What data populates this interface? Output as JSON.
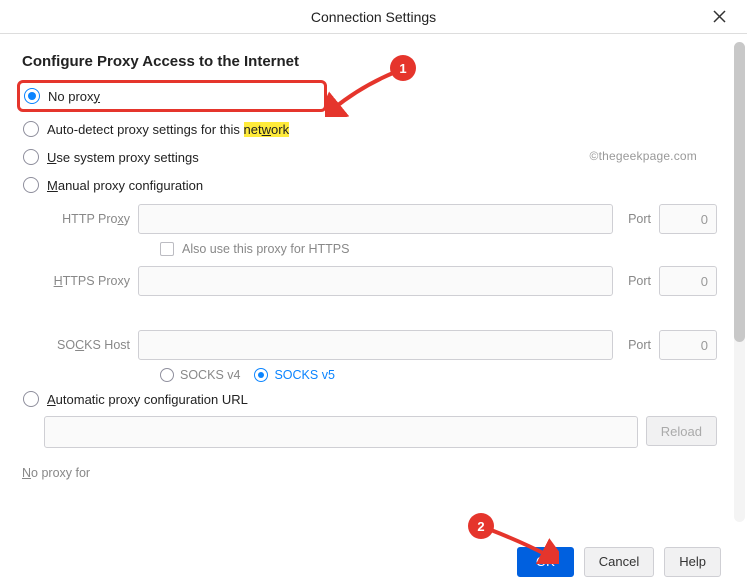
{
  "titlebar": {
    "title": "Connection Settings"
  },
  "section_title": "Configure Proxy Access to the Internet",
  "watermark": "©thegeekpage.com",
  "options": {
    "no_proxy": {
      "pre": "No prox",
      "ul": "y",
      "post": ""
    },
    "auto_detect": {
      "pre": "Auto-detect proxy settings for this ",
      "hl_pre": "net",
      "hl_ul": "w",
      "hl_post": "ork"
    },
    "system": {
      "ul": "U",
      "post": "se system proxy settings"
    },
    "manual": {
      "ul": "M",
      "post": "anual proxy configuration"
    },
    "auto_url": {
      "ul": "A",
      "post": "utomatic proxy configuration URL"
    }
  },
  "fields": {
    "http": {
      "label_pre": "HTTP Pro",
      "label_ul": "x",
      "label_post": "y",
      "port_ul": "P",
      "port_post": "ort",
      "port_value": "0"
    },
    "https": {
      "label_ul": "H",
      "label_post": "TTPS Proxy",
      "port_label": "P",
      "port_post": "ort",
      "port_value": "0"
    },
    "socks": {
      "label_pre": "SO",
      "label_ul": "C",
      "label_post": "KS Host",
      "port_label": "Port",
      "port_value": "0"
    },
    "https_checkbox": {
      "pre": "A",
      "ul": "l",
      "post": "so use this proxy for HTTPS"
    }
  },
  "socks_version": {
    "v4_pre": "SOC",
    "v4_ul": "K",
    "v4_post": "S v4",
    "v5_pre": "SOCKS ",
    "v5_ul": "v",
    "v5_post": "5"
  },
  "reload_btn": "Reload",
  "no_proxy_for": {
    "ul": "N",
    "post": "o proxy for"
  },
  "footer": {
    "ok": "OK",
    "cancel": "Cancel",
    "help_ul": "H",
    "help_post": "elp"
  },
  "annotations": {
    "badge1": "1",
    "badge2": "2"
  }
}
